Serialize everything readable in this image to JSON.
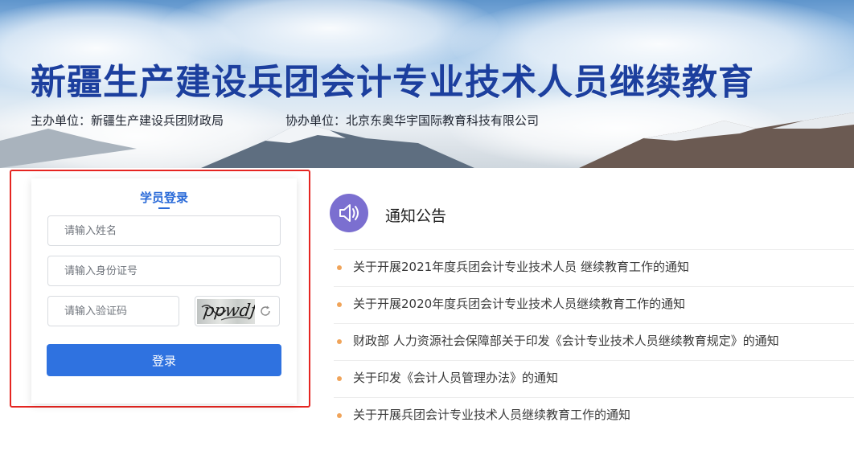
{
  "banner": {
    "title": "新疆生产建设兵团会计专业技术人员继续教育",
    "organizer": "主办单位：新疆生产建设兵团财政局",
    "co_organizer": "协办单位：北京东奥华宇国际教育科技有限公司"
  },
  "login": {
    "title": "学员登录",
    "name_placeholder": "请输入姓名",
    "id_placeholder": "请输入身份证号",
    "captcha_placeholder": "请输入验证码",
    "captcha_text": "ppwdf",
    "submit_label": "登录"
  },
  "notice": {
    "title": "通知公告",
    "icon": "speaker-icon",
    "items": [
      "关于开展2021年度兵团会计专业技术人员 继续教育工作的通知",
      "关于开展2020年度兵团会计专业技术人员继续教育工作的通知",
      "财政部 人力资源社会保障部关于印发《会计专业技术人员继续教育规定》的通知",
      "关于印发《会计人员管理办法》的通知",
      "关于开展兵团会计专业技术人员继续教育工作的通知"
    ]
  },
  "colors": {
    "brand_blue": "#2f72e0",
    "title_blue": "#1c3f9e",
    "highlight_red": "#e52521",
    "bullet_orange": "#f0a45a",
    "notice_icon_purple": "#7b6fd0"
  }
}
